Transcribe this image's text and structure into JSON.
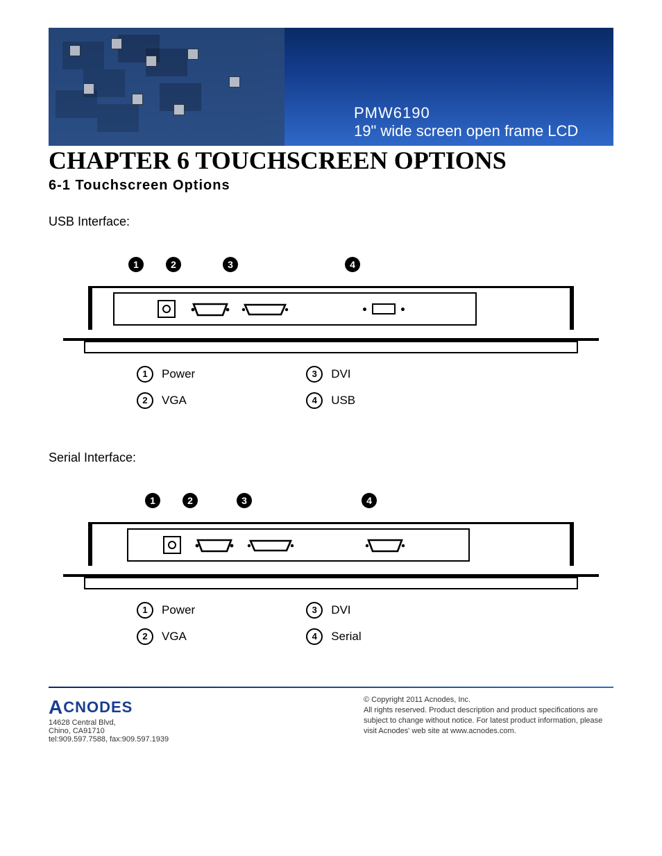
{
  "banner": {
    "model": "PMW6190",
    "desc": "19\" wide screen open frame LCD"
  },
  "chapter_title": "CHAPTER 6 TOUCHSCREEN OPTIONS",
  "section_title": "6-1  Touchscreen  Options",
  "interfaces": [
    {
      "label": "USB Interface:",
      "callouts": [
        "1",
        "2",
        "3",
        "4"
      ],
      "legend": [
        {
          "num": "1",
          "text": "Power"
        },
        {
          "num": "2",
          "text": "VGA"
        },
        {
          "num": "3",
          "text": "DVI"
        },
        {
          "num": "4",
          "text": "USB"
        }
      ],
      "port4_type": "usb"
    },
    {
      "label": "Serial Interface:",
      "callouts": [
        "1",
        "2",
        "3",
        "4"
      ],
      "legend": [
        {
          "num": "1",
          "text": "Power"
        },
        {
          "num": "2",
          "text": "VGA"
        },
        {
          "num": "3",
          "text": "DVI"
        },
        {
          "num": "4",
          "text": "Serial"
        }
      ],
      "port4_type": "serial"
    }
  ],
  "footer": {
    "logo_text": "CNODES",
    "addr1": "14628 Central Blvd,",
    "addr2": "Chino, CA91710",
    "phone": "tel:909.597.7588, fax:909.597.1939",
    "copyright": "© Copyright 2011 Acnodes, Inc.",
    "rights": "All rights reserved. Product description and product specifications are subject to change without notice. For latest product information, please visit Acnodes' web site at www.acnodes.com."
  }
}
